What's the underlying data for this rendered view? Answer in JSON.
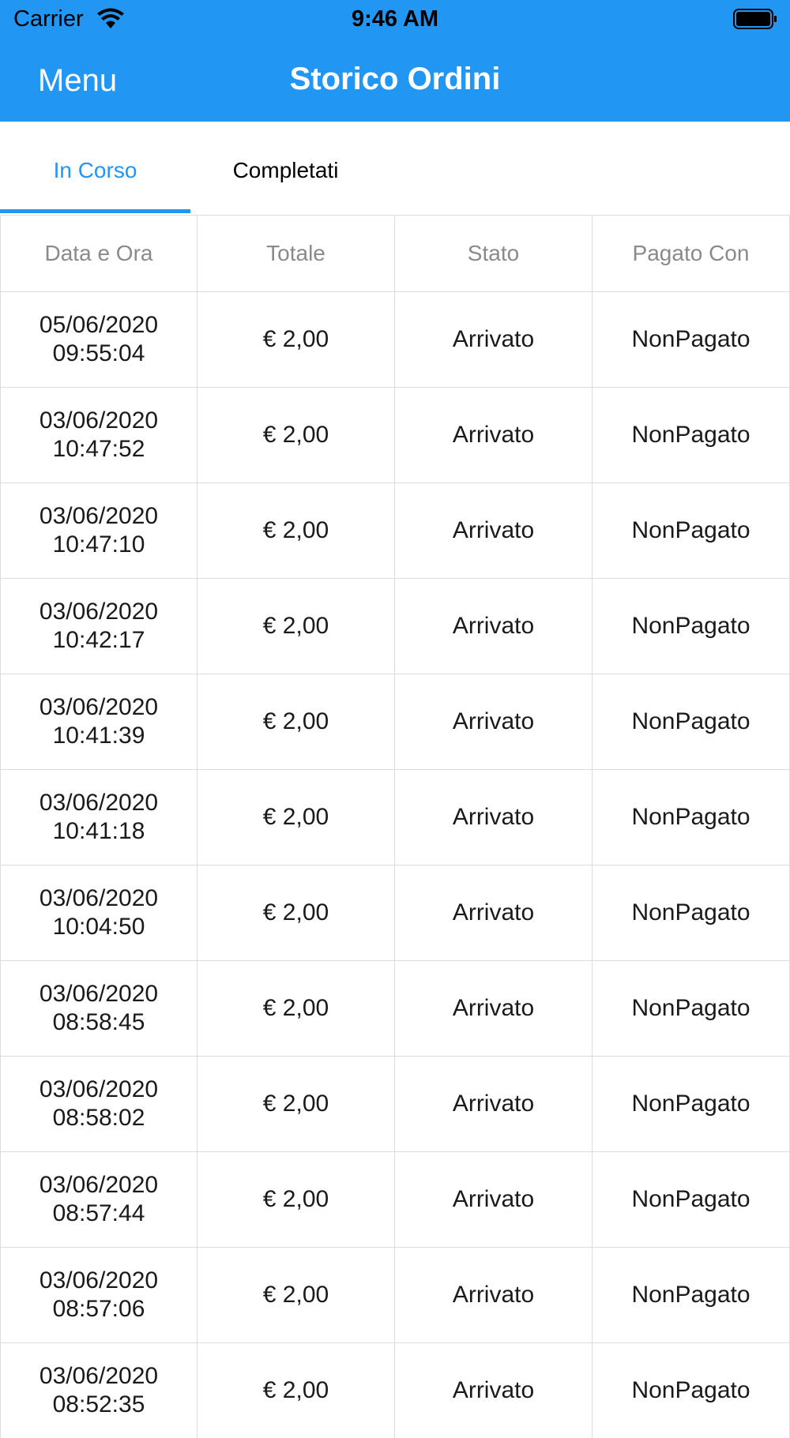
{
  "status_bar": {
    "carrier": "Carrier",
    "time": "9:46 AM"
  },
  "nav": {
    "menu_label": "Menu",
    "title": "Storico Ordini"
  },
  "tabs": [
    {
      "label": "In Corso",
      "active": true
    },
    {
      "label": "Completati",
      "active": false
    }
  ],
  "colors": {
    "accent": "#2196f3",
    "border": "#dcdcdc"
  },
  "table": {
    "headers": [
      "Data e Ora",
      "Totale",
      "Stato",
      "Pagato Con"
    ],
    "rows": [
      {
        "date": "05/06/2020",
        "time": "09:55:04",
        "total": "€ 2,00",
        "status": "Arrivato",
        "paid_with": "NonPagato"
      },
      {
        "date": "03/06/2020",
        "time": "10:47:52",
        "total": "€ 2,00",
        "status": "Arrivato",
        "paid_with": "NonPagato"
      },
      {
        "date": "03/06/2020",
        "time": "10:47:10",
        "total": "€ 2,00",
        "status": "Arrivato",
        "paid_with": "NonPagato"
      },
      {
        "date": "03/06/2020",
        "time": "10:42:17",
        "total": "€ 2,00",
        "status": "Arrivato",
        "paid_with": "NonPagato"
      },
      {
        "date": "03/06/2020",
        "time": "10:41:39",
        "total": "€ 2,00",
        "status": "Arrivato",
        "paid_with": "NonPagato"
      },
      {
        "date": "03/06/2020",
        "time": "10:41:18",
        "total": "€ 2,00",
        "status": "Arrivato",
        "paid_with": "NonPagato"
      },
      {
        "date": "03/06/2020",
        "time": "10:04:50",
        "total": "€ 2,00",
        "status": "Arrivato",
        "paid_with": "NonPagato"
      },
      {
        "date": "03/06/2020",
        "time": "08:58:45",
        "total": "€ 2,00",
        "status": "Arrivato",
        "paid_with": "NonPagato"
      },
      {
        "date": "03/06/2020",
        "time": "08:58:02",
        "total": "€ 2,00",
        "status": "Arrivato",
        "paid_with": "NonPagato"
      },
      {
        "date": "03/06/2020",
        "time": "08:57:44",
        "total": "€ 2,00",
        "status": "Arrivato",
        "paid_with": "NonPagato"
      },
      {
        "date": "03/06/2020",
        "time": "08:57:06",
        "total": "€ 2,00",
        "status": "Arrivato",
        "paid_with": "NonPagato"
      },
      {
        "date": "03/06/2020",
        "time": "08:52:35",
        "total": "€ 2,00",
        "status": "Arrivato",
        "paid_with": "NonPagato"
      }
    ]
  }
}
